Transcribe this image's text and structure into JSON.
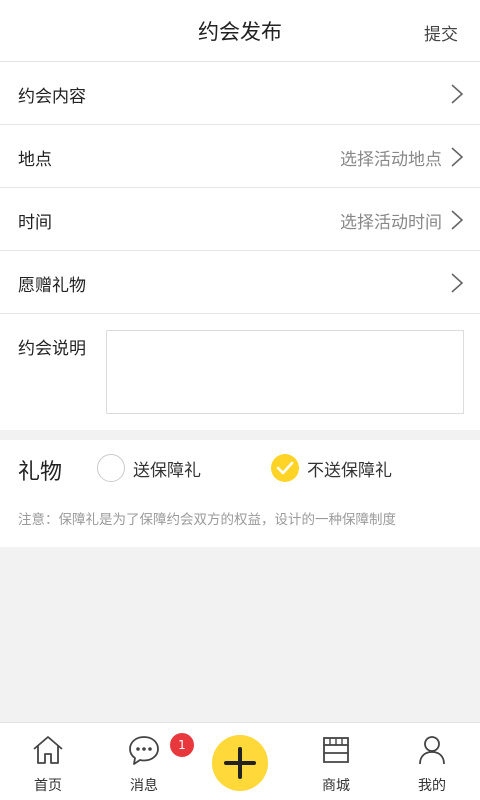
{
  "header": {
    "title": "约会发布",
    "submit_label": "提交"
  },
  "form": {
    "content": {
      "label": "约会内容"
    },
    "location": {
      "label": "地点",
      "value": "选择活动地点"
    },
    "time": {
      "label": "时间",
      "value": "选择活动时间"
    },
    "gift_wish": {
      "label": "愿赠礼物"
    },
    "description": {
      "label": "约会说明",
      "value": ""
    }
  },
  "gift": {
    "label": "礼物",
    "options": [
      {
        "label": "送保障礼",
        "checked": false
      },
      {
        "label": "不送保障礼",
        "checked": true
      }
    ],
    "note": "注意：保障礼是为了保障约会双方的权益，设计的一种保障制度"
  },
  "tabbar": {
    "items": [
      {
        "label": "首页",
        "icon": "home-icon"
      },
      {
        "label": "消息",
        "icon": "message-icon",
        "badge": "1"
      },
      {
        "label": "",
        "icon": "plus-icon"
      },
      {
        "label": "商城",
        "icon": "shop-icon"
      },
      {
        "label": "我的",
        "icon": "profile-icon"
      }
    ]
  },
  "colors": {
    "accent": "#ffd426",
    "badge": "#e8383d",
    "background": "#f2f2f2"
  }
}
